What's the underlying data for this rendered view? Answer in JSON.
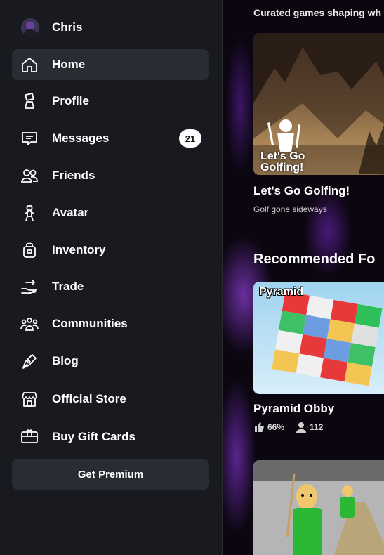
{
  "user": {
    "name": "Chris"
  },
  "nav": {
    "items": [
      {
        "label": "Home",
        "icon": "home-icon"
      },
      {
        "label": "Profile",
        "icon": "profile-icon"
      },
      {
        "label": "Messages",
        "icon": "messages-icon",
        "badge": "21"
      },
      {
        "label": "Friends",
        "icon": "friends-icon"
      },
      {
        "label": "Avatar",
        "icon": "avatar-icon"
      },
      {
        "label": "Inventory",
        "icon": "inventory-icon"
      },
      {
        "label": "Trade",
        "icon": "trade-icon"
      },
      {
        "label": "Communities",
        "icon": "communities-icon"
      },
      {
        "label": "Blog",
        "icon": "blog-icon"
      },
      {
        "label": "Official Store",
        "icon": "store-icon"
      },
      {
        "label": "Buy Gift Cards",
        "icon": "gift-card-icon"
      }
    ],
    "active": "Home",
    "premium_label": "Get Premium"
  },
  "main": {
    "curated_heading": "Curated games shaping wh",
    "featured": {
      "title": "Let's Go Golfing!",
      "subtitle": "Golf gone sideways",
      "thumb_text": "Let's Go Golfing!"
    },
    "recommended_heading": "Recommended Fo",
    "games": [
      {
        "title": "Pyramid Obby",
        "thumb_text": "Pyramid",
        "rating": "66%",
        "players": "112"
      }
    ]
  },
  "colors": {
    "sidebar_bg": "#191a1f",
    "active_item_bg": "#2a2c33",
    "badge_bg": "#ffffff",
    "main_bg": "#0b0610"
  }
}
